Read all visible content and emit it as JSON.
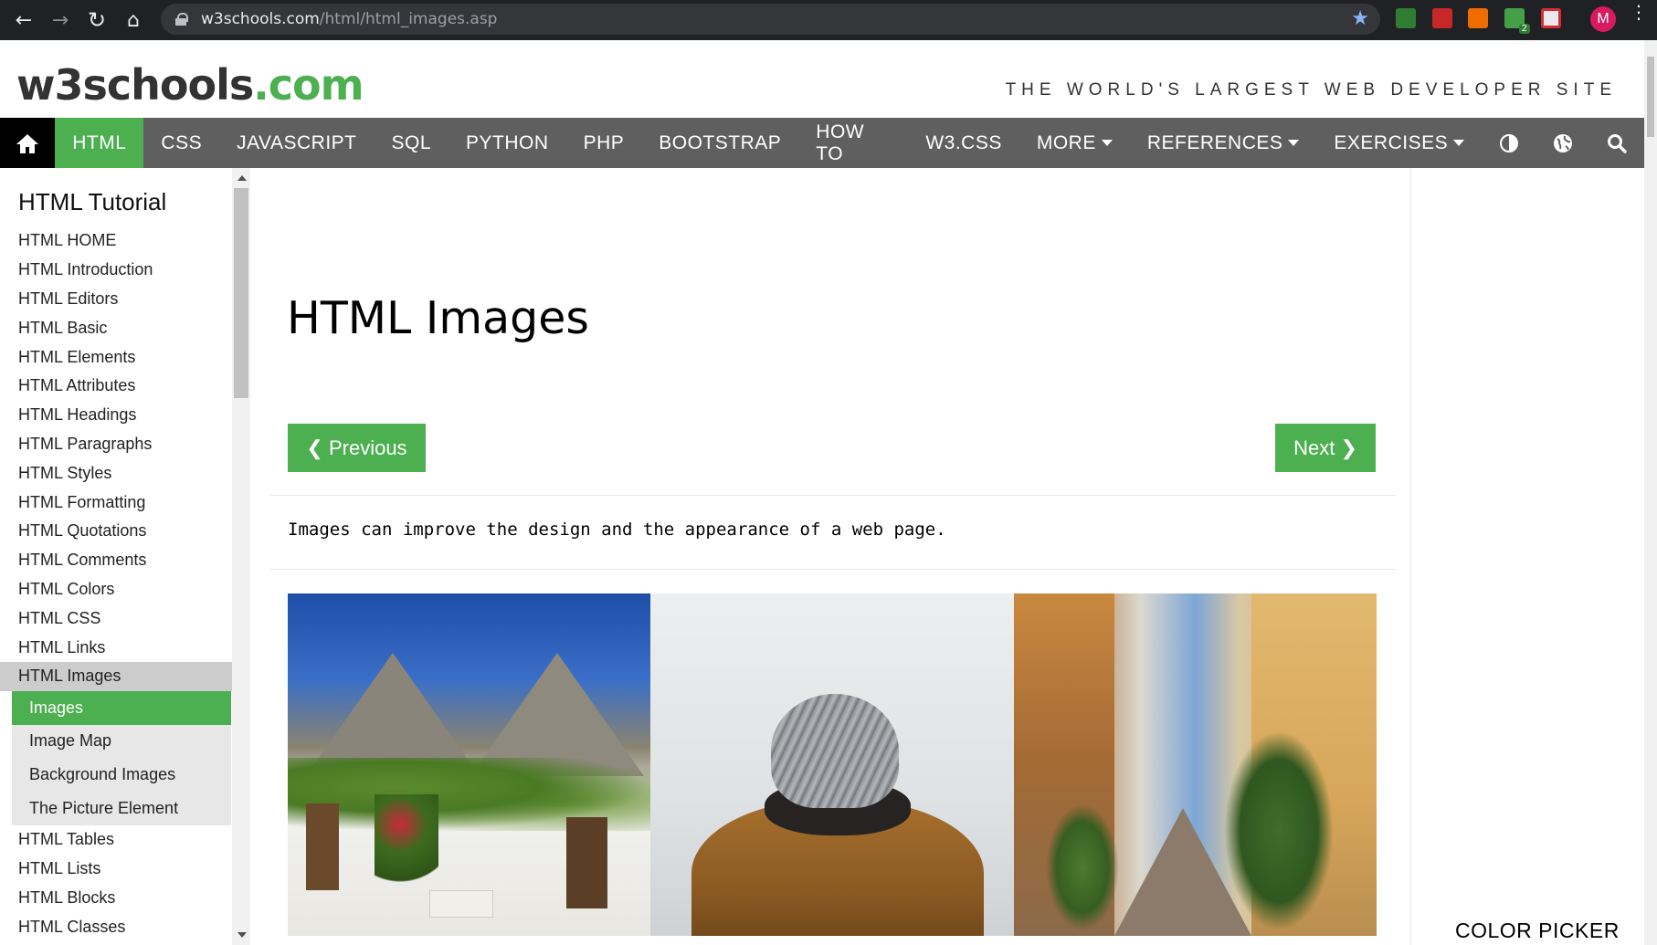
{
  "browser": {
    "url_host": "w3schools.com",
    "url_path": "/html/html_images.asp",
    "extension_badge": "2",
    "profile_initial": "M"
  },
  "header": {
    "logo_prefix": "w3schools",
    "logo_suffix": ".com",
    "tagline": "THE WORLD'S LARGEST WEB DEVELOPER SITE"
  },
  "topnav": {
    "items": [
      "HTML",
      "CSS",
      "JAVASCRIPT",
      "SQL",
      "PYTHON",
      "PHP",
      "BOOTSTRAP",
      "HOW TO",
      "W3.CSS",
      "MORE"
    ],
    "right_items": [
      "REFERENCES",
      "EXERCISES"
    ],
    "active": "HTML"
  },
  "sidebar": {
    "title": "HTML Tutorial",
    "items_before": [
      "HTML HOME",
      "HTML Introduction",
      "HTML Editors",
      "HTML Basic",
      "HTML Elements",
      "HTML Attributes",
      "HTML Headings",
      "HTML Paragraphs",
      "HTML Styles",
      "HTML Formatting",
      "HTML Quotations",
      "HTML Comments",
      "HTML Colors",
      "HTML CSS",
      "HTML Links"
    ],
    "current": "HTML Images",
    "sub_items": [
      "Images",
      "Image Map",
      "Background Images",
      "The Picture Element"
    ],
    "items_after": [
      "HTML Tables",
      "HTML Lists",
      "HTML Blocks",
      "HTML Classes"
    ]
  },
  "main": {
    "title": "HTML Images",
    "prev_label": "❮ Previous",
    "next_label": "Next ❯",
    "intro": "Images can improve the design and the appearance of a web page."
  },
  "right": {
    "color_picker_label": "COLOR PICKER"
  },
  "colors": {
    "accent": "#4caf50",
    "nav_bg": "#5f5f5f",
    "chrome_bg": "#202124"
  }
}
